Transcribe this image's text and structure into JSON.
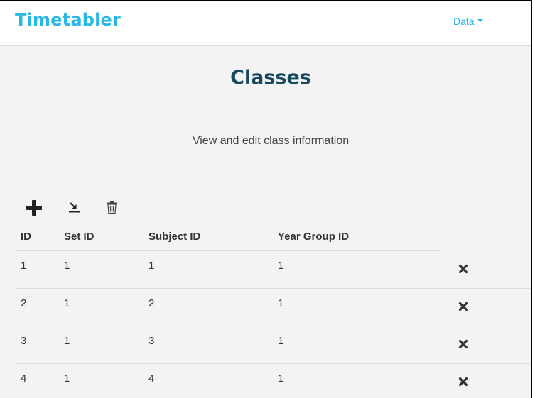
{
  "brand": "Timetabler",
  "nav": {
    "data_menu": "Data"
  },
  "page": {
    "title": "Classes",
    "subtitle": "View and edit class information"
  },
  "toolbar": {
    "add_icon": "plus-icon",
    "import_icon": "import-icon",
    "delete_icon": "trash-icon"
  },
  "table": {
    "headers": [
      "ID",
      "Set ID",
      "Subject ID",
      "Year Group ID"
    ],
    "rows": [
      [
        "1",
        "1",
        "1",
        "1"
      ],
      [
        "2",
        "1",
        "2",
        "1"
      ],
      [
        "3",
        "1",
        "3",
        "1"
      ],
      [
        "4",
        "1",
        "4",
        "1"
      ]
    ],
    "row_action_icon": "close-icon"
  },
  "colors": {
    "brand": "#29b6e8",
    "title": "#16495e",
    "background": "#f3f3f3"
  }
}
